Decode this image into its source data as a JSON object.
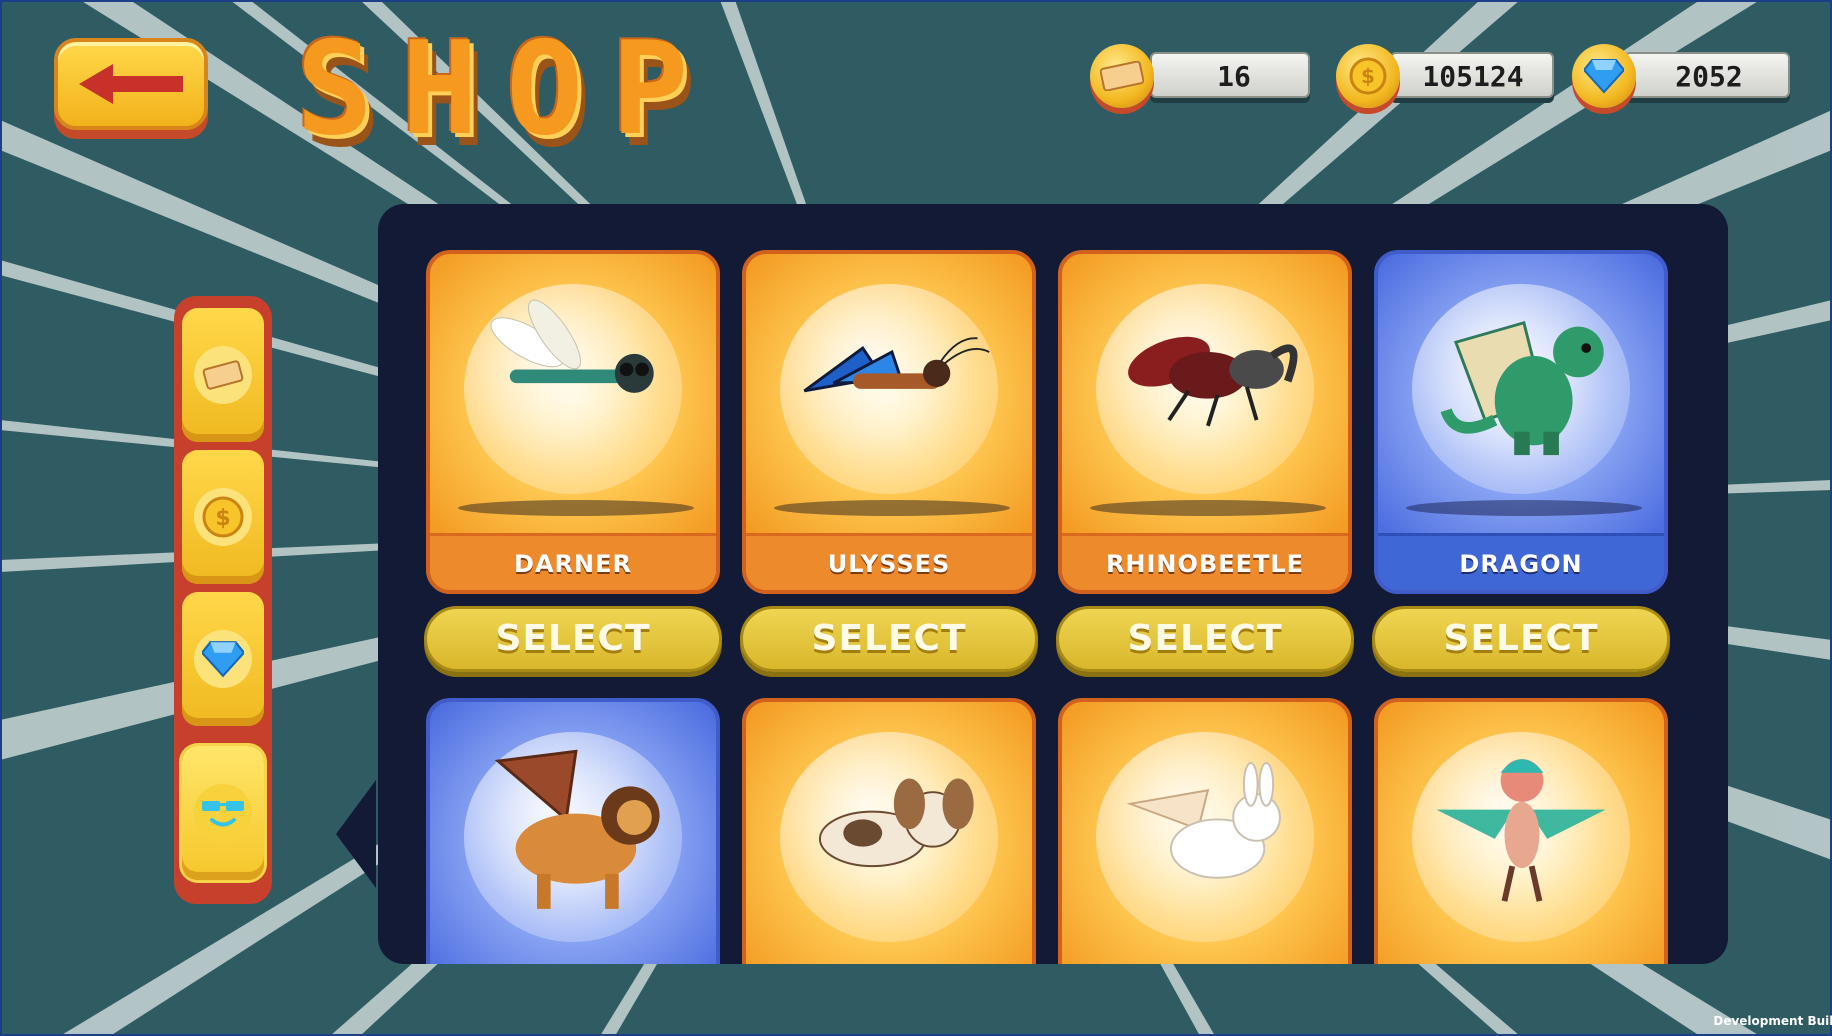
{
  "header": {
    "title": "SHOP",
    "back_button_icon": "back-arrow-icon"
  },
  "currencies": [
    {
      "name": "tickets",
      "icon": "ticket-icon",
      "value": "16"
    },
    {
      "name": "coins",
      "icon": "coin-icon",
      "value": "105124"
    },
    {
      "name": "gems",
      "icon": "diamond-icon",
      "value": "2052"
    }
  ],
  "sidebar": {
    "items": [
      {
        "icon": "ticket-icon"
      },
      {
        "icon": "coin-icon"
      },
      {
        "icon": "diamond-icon"
      },
      {
        "icon": "cool-face-icon"
      }
    ]
  },
  "shop": {
    "cards": [
      {
        "name": "DARNER",
        "tier": "orange",
        "creature": "dragonfly-icon",
        "button": "SELECT"
      },
      {
        "name": "ULYSSES",
        "tier": "orange",
        "creature": "butterfly-icon",
        "button": "SELECT"
      },
      {
        "name": "RHINOBEETLE",
        "tier": "orange",
        "creature": "beetle-icon",
        "button": "SELECT"
      },
      {
        "name": "DRAGON",
        "tier": "blue",
        "creature": "dragon-icon",
        "button": "SELECT"
      },
      {
        "name": "",
        "tier": "blue",
        "creature": "winged-lion-icon"
      },
      {
        "name": "",
        "tier": "orange",
        "creature": "winged-dog-icon"
      },
      {
        "name": "",
        "tier": "orange",
        "creature": "winged-rabbit-icon"
      },
      {
        "name": "",
        "tier": "orange",
        "creature": "harpy-icon"
      }
    ]
  },
  "footer": {
    "build_label": "Development Build"
  },
  "colors": {
    "background": "#2f5c63",
    "panel": "#131a35",
    "orange_card": "#f39b22",
    "blue_card": "#4d6de0",
    "select_button": "#e3c43c"
  }
}
